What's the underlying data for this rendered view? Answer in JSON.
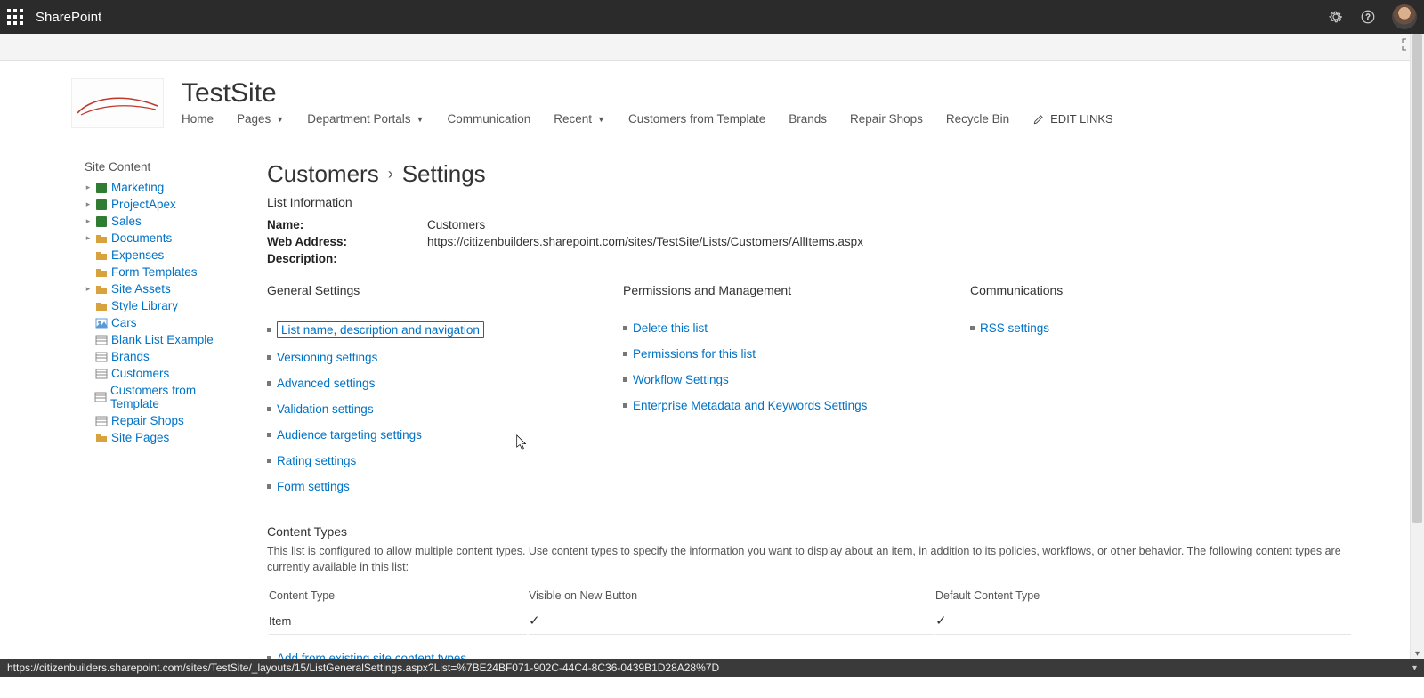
{
  "suite": {
    "app": "SharePoint"
  },
  "site": {
    "title": "TestSite",
    "nav": [
      {
        "label": "Home",
        "dd": false
      },
      {
        "label": "Pages",
        "dd": true
      },
      {
        "label": "Department Portals",
        "dd": true
      },
      {
        "label": "Communication",
        "dd": false
      },
      {
        "label": "Recent",
        "dd": true
      },
      {
        "label": "Customers from Template",
        "dd": false
      },
      {
        "label": "Brands",
        "dd": false
      },
      {
        "label": "Repair Shops",
        "dd": false
      },
      {
        "label": "Recycle Bin",
        "dd": false
      }
    ],
    "editLinks": "EDIT LINKS"
  },
  "leftnav": {
    "title": "Site Content",
    "items": [
      {
        "label": "Marketing",
        "icon": "site",
        "expandable": true
      },
      {
        "label": "ProjectApex",
        "icon": "site",
        "expandable": true
      },
      {
        "label": "Sales",
        "icon": "site",
        "expandable": true
      },
      {
        "label": "Documents",
        "icon": "lib",
        "expandable": true
      },
      {
        "label": "Expenses",
        "icon": "lib",
        "expandable": false
      },
      {
        "label": "Form Templates",
        "icon": "lib",
        "expandable": false
      },
      {
        "label": "Site Assets",
        "icon": "lib",
        "expandable": true
      },
      {
        "label": "Style Library",
        "icon": "lib",
        "expandable": false
      },
      {
        "label": "Cars",
        "icon": "pic",
        "expandable": false
      },
      {
        "label": "Blank List Example",
        "icon": "list",
        "expandable": false
      },
      {
        "label": "Brands",
        "icon": "list",
        "expandable": false
      },
      {
        "label": "Customers",
        "icon": "list",
        "expandable": false
      },
      {
        "label": "Customers from Template",
        "icon": "list",
        "expandable": false
      },
      {
        "label": "Repair Shops",
        "icon": "list",
        "expandable": false
      },
      {
        "label": "Site Pages",
        "icon": "lib",
        "expandable": false
      }
    ]
  },
  "pageTitle": {
    "crumb": "Customers",
    "current": "Settings"
  },
  "listInfo": {
    "heading": "List Information",
    "name_label": "Name:",
    "name_value": "Customers",
    "addr_label": "Web Address:",
    "addr_value": "https://citizenbuilders.sharepoint.com/sites/TestSite/Lists/Customers/AllItems.aspx",
    "desc_label": "Description:",
    "desc_value": ""
  },
  "settings": {
    "general": {
      "title": "General Settings",
      "links": [
        "List name, description and navigation",
        "Versioning settings",
        "Advanced settings",
        "Validation settings",
        "Audience targeting settings",
        "Rating settings",
        "Form settings"
      ]
    },
    "perm": {
      "title": "Permissions and Management",
      "links": [
        "Delete this list",
        "Permissions for this list",
        "Workflow Settings",
        "Enterprise Metadata and Keywords Settings"
      ]
    },
    "comm": {
      "title": "Communications",
      "links": [
        "RSS settings"
      ]
    }
  },
  "contentTypes": {
    "heading": "Content Types",
    "desc": "This list is configured to allow multiple content types. Use content types to specify the information you want to display about an item, in addition to its policies, workflows, or other behavior. The following content types are currently available in this list:",
    "cols": {
      "ct": "Content Type",
      "vis": "Visible on New Button",
      "def": "Default Content Type"
    },
    "rows": [
      {
        "ct": "Item",
        "vis": true,
        "def": true
      }
    ],
    "addLink": "Add from existing site content types"
  },
  "statusbar": {
    "url": "https://citizenbuilders.sharepoint.com/sites/TestSite/_layouts/15/ListGeneralSettings.aspx?List=%7BE24BF071-902C-44C4-8C36-0439B1D28A28%7D"
  }
}
